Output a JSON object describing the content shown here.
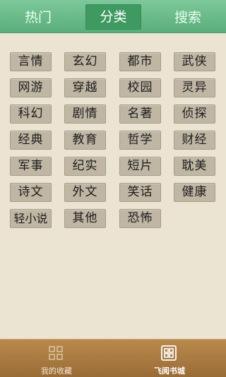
{
  "tabs": [
    {
      "label": "热门"
    },
    {
      "label": "分类"
    },
    {
      "label": "搜索"
    }
  ],
  "categories": [
    "言情",
    "玄幻",
    "都市",
    "武侠",
    "网游",
    "穿越",
    "校园",
    "灵异",
    "科幻",
    "剧情",
    "名著",
    "侦探",
    "经典",
    "教育",
    "哲学",
    "财经",
    "军事",
    "纪实",
    "短片",
    "耽美",
    "诗文",
    "外文",
    "笑话",
    "健康",
    "轻小说",
    "其他",
    "恐怖"
  ],
  "bottom_nav": [
    {
      "label": "我的收藏",
      "icon": "grid-icon"
    },
    {
      "label": "飞阅书城",
      "icon": "bookstore-grid-icon"
    }
  ],
  "colors": {
    "accent": "#5aae7b",
    "selected_tab": "#3f9a61",
    "background": "#ece4d3",
    "bottom_bar": "#9a6c35"
  }
}
